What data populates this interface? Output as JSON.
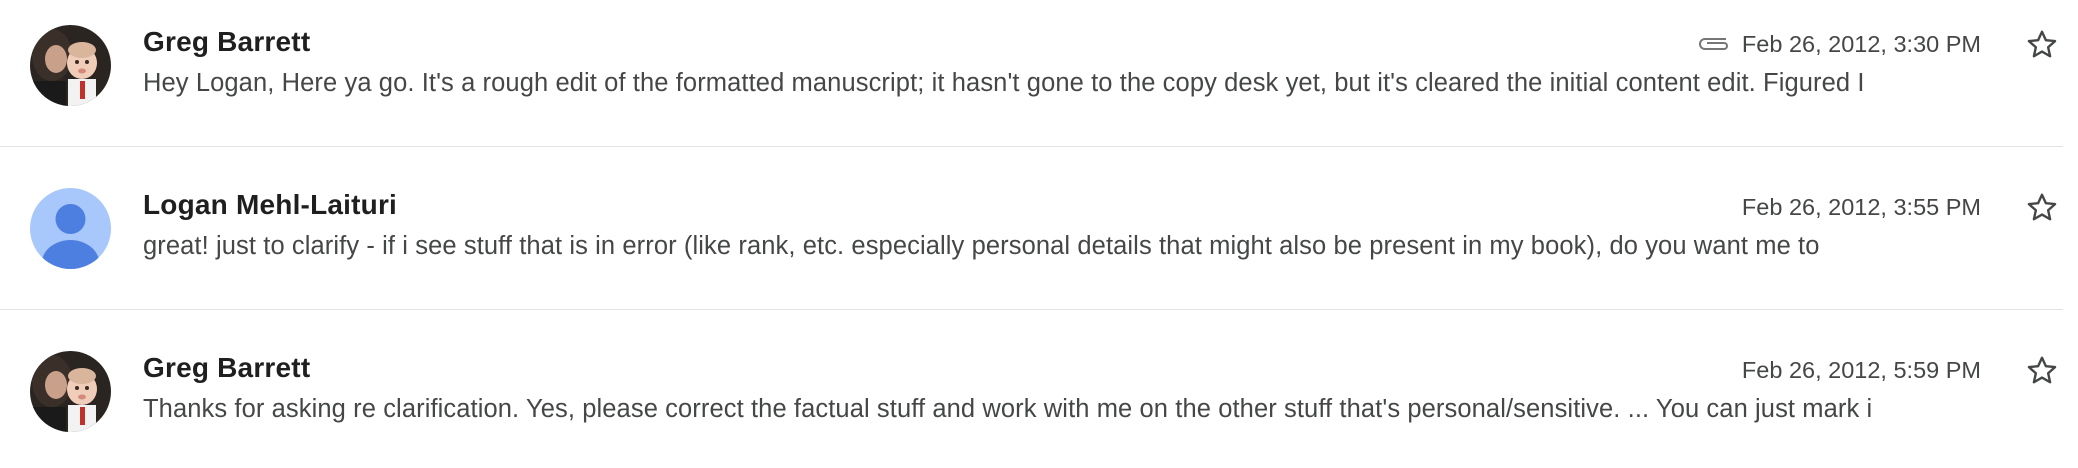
{
  "messages": [
    {
      "sender": "Greg Barrett",
      "snippet": "Hey Logan, Here ya go. It's a rough edit of the formatted manuscript; it hasn't gone to the copy desk yet, but it's cleared the initial content edit. Figured I",
      "date": "Feb 26, 2012, 3:30 PM",
      "has_attachment": true,
      "avatar": "photo-avatar",
      "starred": false
    },
    {
      "sender": "Logan Mehl-Laituri",
      "snippet": "great! just to clarify - if i see stuff that is in error (like rank, etc. especially personal details that might also be present in my book), do you want me to",
      "date": "Feb 26, 2012, 3:55 PM",
      "has_attachment": false,
      "avatar": "default-person-avatar",
      "starred": false
    },
    {
      "sender": "Greg Barrett",
      "snippet": "Thanks for asking re clarification. Yes, please correct the factual stuff and work with me on the other stuff that's personal/sensitive. ... You can just mark i",
      "date": "Feb 26, 2012, 5:59 PM",
      "has_attachment": false,
      "avatar": "photo-avatar",
      "starred": false
    }
  ],
  "colors": {
    "sender_text": "#1f1f1f",
    "snippet_text": "#444746",
    "divider": "#e3e3e3",
    "default_avatar_bg": "#a8c7fa",
    "default_avatar_fg": "#4d7fe0",
    "star_outline": "#444746"
  }
}
